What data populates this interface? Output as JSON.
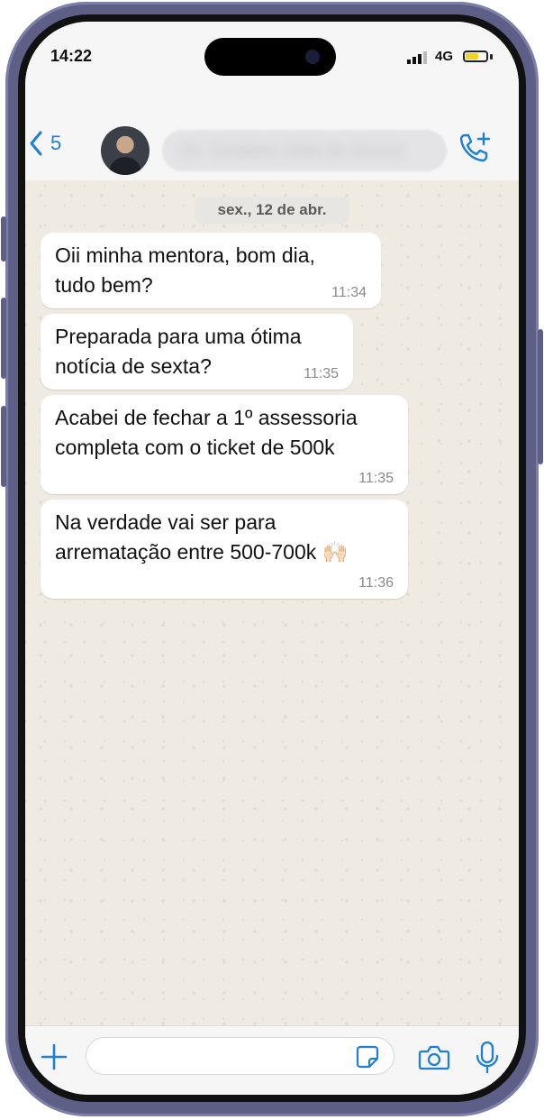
{
  "status_bar": {
    "time": "14:22",
    "network": "4G"
  },
  "header": {
    "back_count": "5",
    "contact_name": "Dr. Gustavo José de Souza",
    "icons": {
      "back": "chevron-left-icon",
      "call": "phone-plus-icon"
    }
  },
  "chat": {
    "date_label": "sex., 12 de abr.",
    "messages": [
      {
        "text": "Oii minha mentora, bom dia,\ntudo bem?",
        "time": "11:34"
      },
      {
        "text": "Preparada para uma ótima\nnotícia de sexta?",
        "time": "11:35"
      },
      {
        "text": "Acabei de fechar a 1º assessoria\ncompleta com o ticket de 500k",
        "time": "11:35"
      },
      {
        "text": "Na verdade vai ser para\narrematação entre 500-700k 🙌🏻",
        "time": "11:36"
      }
    ]
  },
  "input_bar": {
    "icons": [
      "plus-icon",
      "sticker-icon",
      "camera-icon",
      "microphone-icon"
    ]
  },
  "colors": {
    "accent": "#1f7fd4",
    "chat_background": "#efeae2",
    "frame": "#5d5f87"
  }
}
